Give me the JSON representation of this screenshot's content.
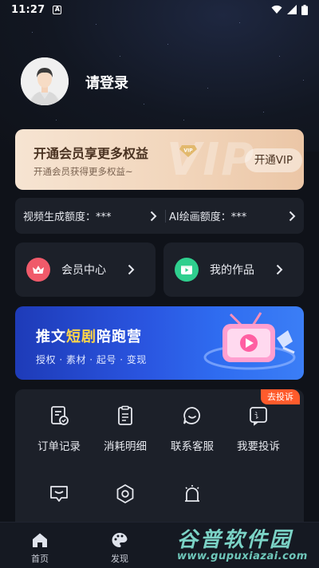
{
  "status_bar": {
    "time": "11:27",
    "notification_letter": "A"
  },
  "profile": {
    "login_label": "请登录"
  },
  "vip": {
    "title": "开通会员享更多权益",
    "subtitle": "开通会员获得更多权益~",
    "button_label": "开通VIP",
    "watermark": "VIP",
    "badge_text": "VIP"
  },
  "quota": {
    "video_label": "视频生成额度：***",
    "ai_label": "AI绘画额度：***"
  },
  "tiles": [
    {
      "label": "会员中心",
      "icon": "crown-icon",
      "color": "#f05a6a"
    },
    {
      "label": "我的作品",
      "icon": "video-icon",
      "color": "#2fcf8e"
    }
  ],
  "banner": {
    "title_part1": "推文",
    "title_highlight": "短剧",
    "title_part2": "陪跑营",
    "subtitle": "授权 · 素材 · 起号 · 变现"
  },
  "tools": {
    "complain_badge": "去投诉",
    "items": [
      {
        "label": "订单记录",
        "icon": "order-record-icon"
      },
      {
        "label": "消耗明细",
        "icon": "consumption-detail-icon"
      },
      {
        "label": "联系客服",
        "icon": "customer-service-icon"
      },
      {
        "label": "我要投诉",
        "icon": "complaint-icon"
      },
      {
        "label": "",
        "icon": "message-icon"
      },
      {
        "label": "",
        "icon": "settings-icon"
      },
      {
        "label": "",
        "icon": "notification-bell-icon"
      }
    ]
  },
  "bottom_nav": [
    {
      "label": "首页",
      "icon": "home-icon"
    },
    {
      "label": "发现",
      "icon": "discover-icon"
    }
  ],
  "watermark": {
    "line1": "谷普软件园",
    "line2": "www.gupuxiazai.com"
  }
}
